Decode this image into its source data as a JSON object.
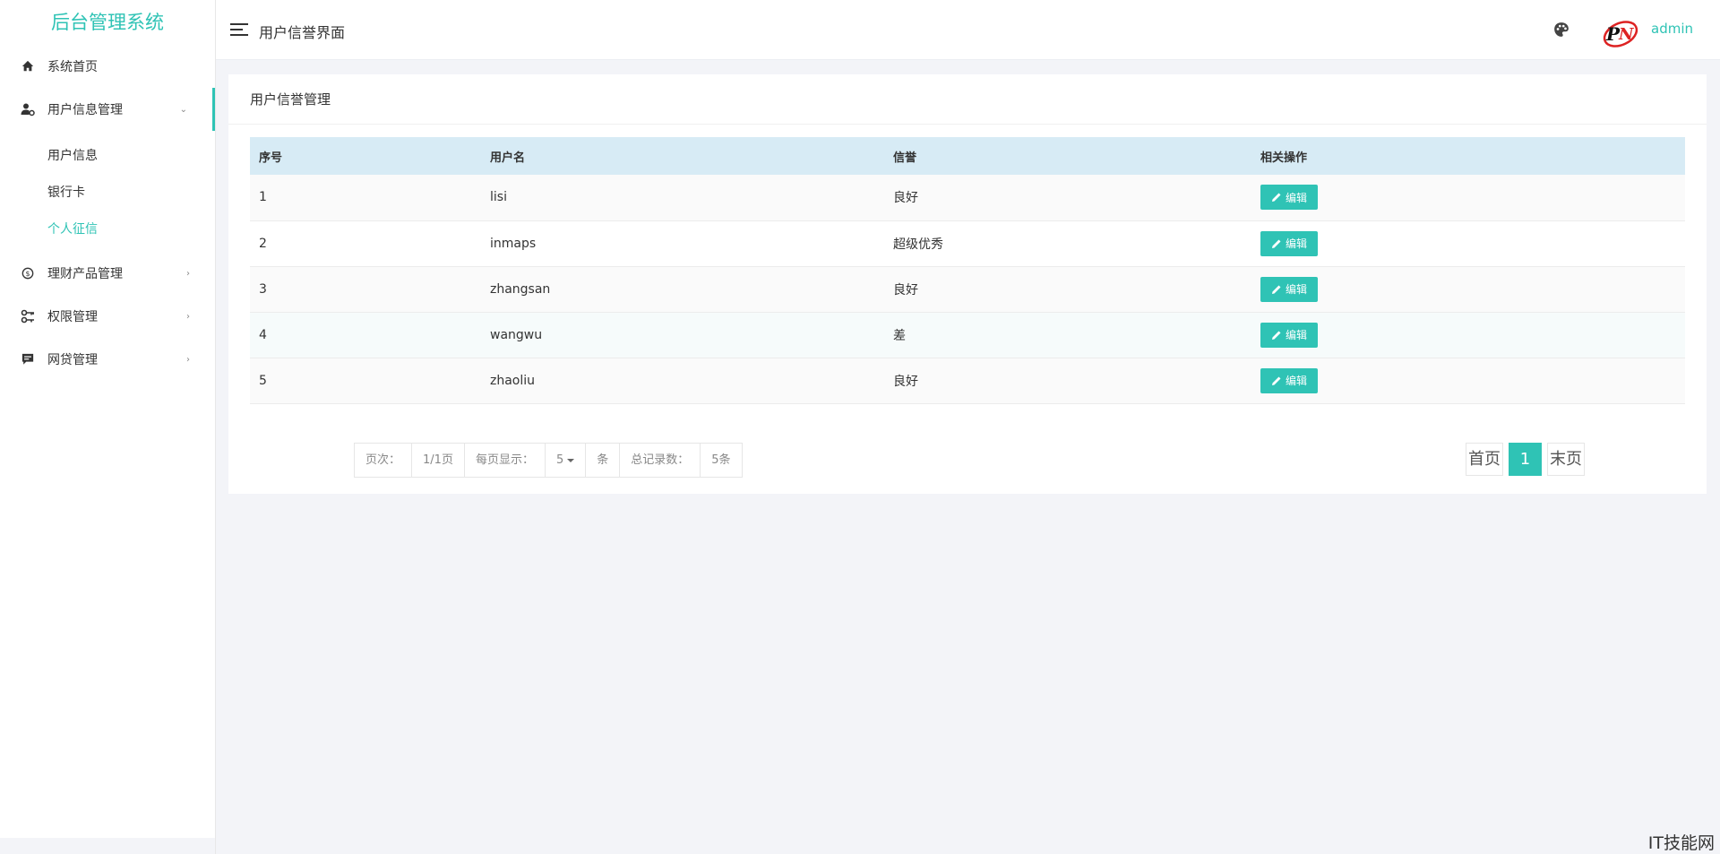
{
  "app": {
    "title": "后台管理系统"
  },
  "sidebar": {
    "items": [
      {
        "label": "系统首页",
        "icon": "home-icon"
      },
      {
        "label": "用户信息管理",
        "icon": "user-settings-icon",
        "arrow": "⌄"
      },
      {
        "label": "理财产品管理",
        "icon": "money-icon",
        "arrow": "›"
      },
      {
        "label": "权限管理",
        "icon": "key-icon",
        "arrow": "›"
      },
      {
        "label": "网贷管理",
        "icon": "chat-icon",
        "arrow": "›"
      }
    ],
    "submenu": [
      "用户信息",
      "银行卡",
      "个人征信"
    ]
  },
  "header": {
    "title": "用户信誉界面",
    "username": "admin"
  },
  "card": {
    "title": "用户信誉管理"
  },
  "table": {
    "columns": [
      "序号",
      "用户名",
      "信誉",
      "相关操作"
    ],
    "rows": [
      {
        "id": "1",
        "name": "lisi",
        "credit": "良好"
      },
      {
        "id": "2",
        "name": "inmaps",
        "credit": "超级优秀"
      },
      {
        "id": "3",
        "name": "zhangsan",
        "credit": "良好"
      },
      {
        "id": "4",
        "name": "wangwu",
        "credit": "差"
      },
      {
        "id": "5",
        "name": "zhaoliu",
        "credit": "良好"
      }
    ],
    "edit_label": "编辑"
  },
  "pagination": {
    "page_label": "页次：",
    "page_value": "1/1页",
    "per_page_label": "每页显示：",
    "per_page_value": "5",
    "per_page_unit": "条",
    "total_label": "总记录数：",
    "total_value": "5条",
    "first": "首页",
    "current": "1",
    "last": "末页"
  },
  "watermark": "IT技能网",
  "colors": {
    "accent": "#2fc3b5",
    "table_header": "#d7ebf5"
  }
}
